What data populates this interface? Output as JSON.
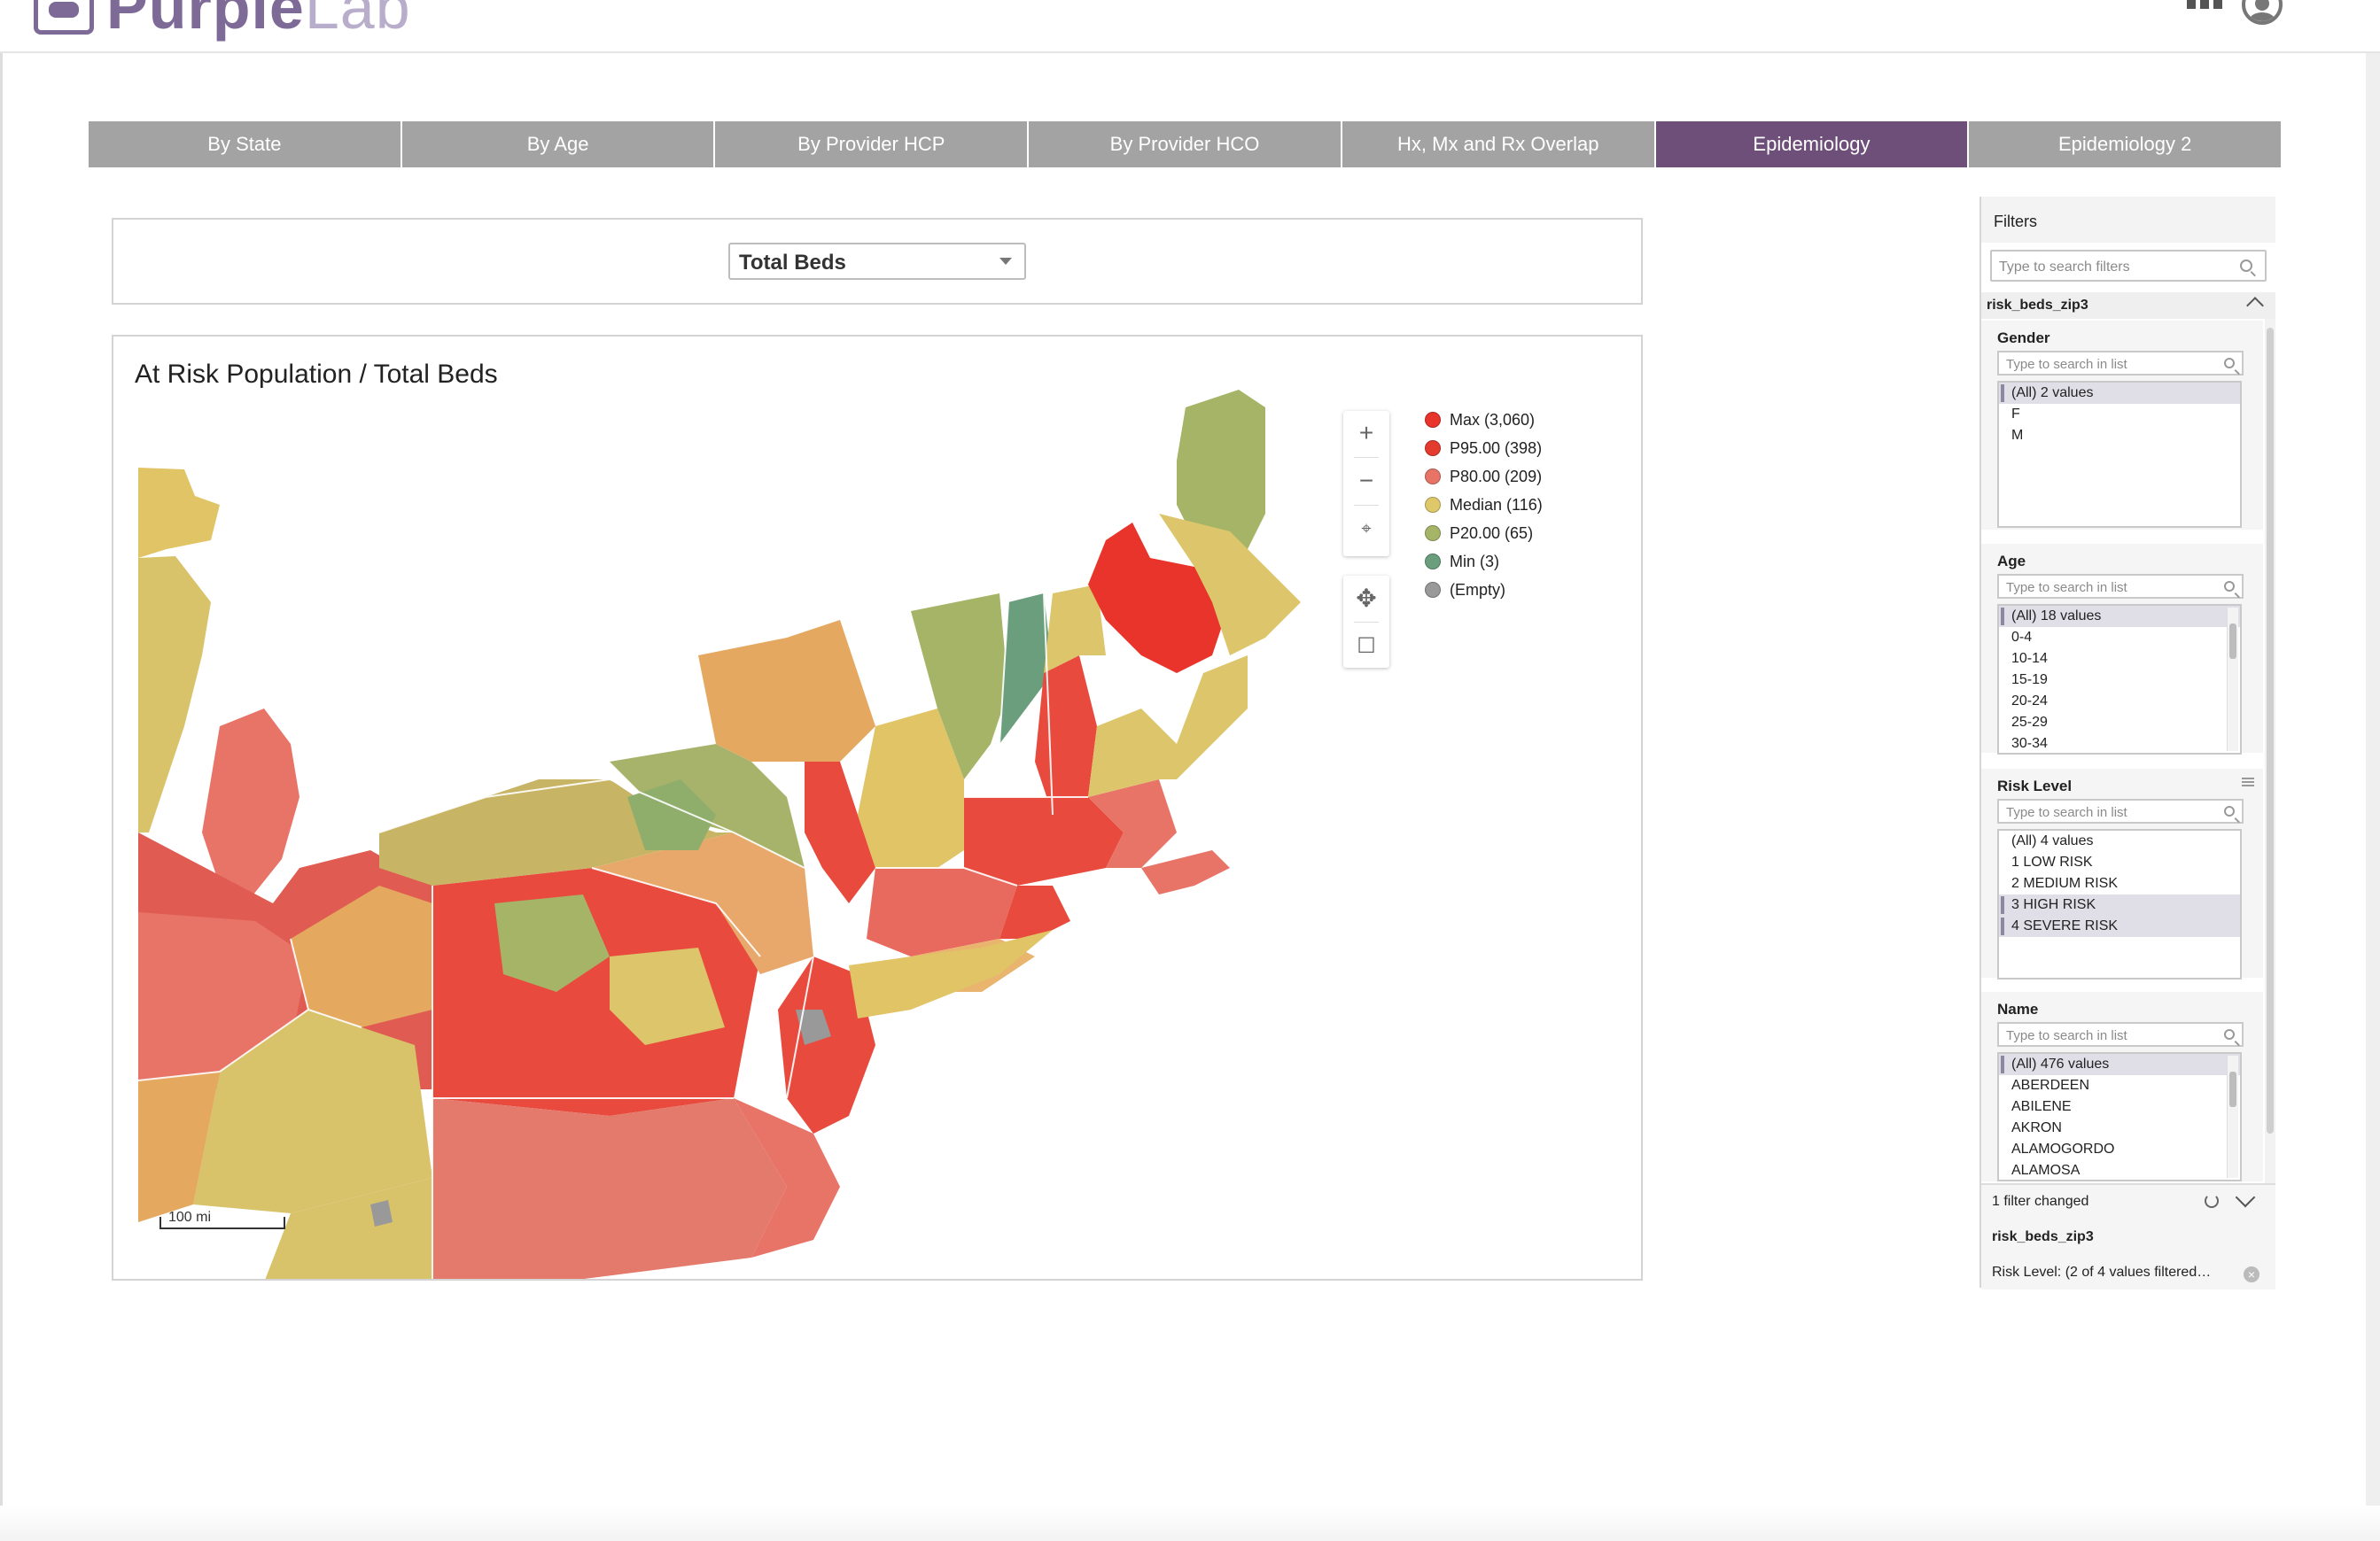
{
  "app": {
    "logo_main": "Purple",
    "logo_light": "Lab"
  },
  "tabs": [
    {
      "label": "By State"
    },
    {
      "label": "By Age"
    },
    {
      "label": "By Provider HCP"
    },
    {
      "label": "By Provider HCO"
    },
    {
      "label": "Hx, Mx and Rx Overlap"
    },
    {
      "label": "Epidemiology",
      "active": true
    },
    {
      "label": "Epidemiology 2"
    }
  ],
  "measure_select": {
    "value": "Total Beds"
  },
  "map": {
    "title": "At Risk Population / Total Beds",
    "scale_label": "100 mi",
    "controls": [
      "zoom-in",
      "zoom-out",
      "reset-view",
      "pan",
      "select-rectangle"
    ],
    "legend": [
      {
        "label": "Max (3,060)",
        "color": "#e8342a"
      },
      {
        "label": "P95.00 (398)",
        "color": "#e43b2f"
      },
      {
        "label": "P80.00 (209)",
        "color": "#e87468"
      },
      {
        "label": "Median (116)",
        "color": "#dec86a"
      },
      {
        "label": "P20.00 (65)",
        "color": "#a6b468"
      },
      {
        "label": "Min (3)",
        "color": "#6a9e7d"
      },
      {
        "label": "(Empty)",
        "color": "#999999"
      }
    ]
  },
  "filters": {
    "title": "Filters",
    "search_placeholder": "Type to search filters",
    "datasource": "risk_beds_zip3",
    "list_search_placeholder": "Type to search in list",
    "cards": {
      "gender": {
        "title": "Gender",
        "options": [
          "(All) 2 values",
          "F",
          "M"
        ],
        "selected": [
          0
        ]
      },
      "age": {
        "title": "Age",
        "options": [
          "(All) 18 values",
          "0-4",
          "10-14",
          "15-19",
          "20-24",
          "25-29",
          "30-34"
        ],
        "selected": [
          0
        ]
      },
      "risk": {
        "title": "Risk Level",
        "options": [
          "(All) 4 values",
          "1 LOW RISK",
          "2 MEDIUM RISK",
          "3 HIGH RISK",
          "4 SEVERE RISK"
        ],
        "selected": [
          3,
          4
        ]
      },
      "name": {
        "title": "Name",
        "options": [
          "(All) 476 values",
          "ABERDEEN",
          "ABILENE",
          "AKRON",
          "ALAMOGORDO",
          "ALAMOSA"
        ],
        "selected": [
          0
        ]
      }
    },
    "changed": {
      "summary": "1 filter changed",
      "datasource": "risk_beds_zip3",
      "detail": "Risk Level: (2 of 4 values filtered…"
    }
  }
}
